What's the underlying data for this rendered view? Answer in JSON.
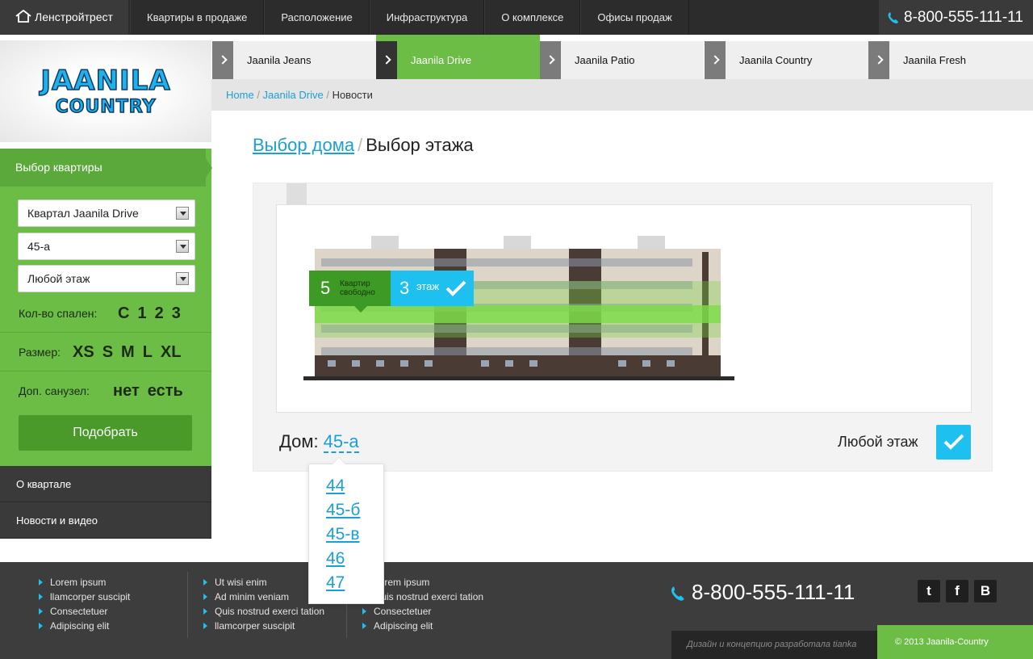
{
  "nav": {
    "brand": "Ленстройтрест",
    "items": [
      "Квартиры в продаже",
      "Расположение",
      "Инфраструктура",
      "О комплексе",
      "Офисы продаж"
    ],
    "phone": "8-800-555-111-11"
  },
  "logo": {
    "line1": "JAANILA",
    "line2": "COUNTRY"
  },
  "building_tabs": [
    {
      "label": "Jaanila Jeans",
      "active": false
    },
    {
      "label": "Jaanila Drive",
      "active": true
    },
    {
      "label": "Jaanila Patio",
      "active": false
    },
    {
      "label": "Jaanila Country",
      "active": false
    },
    {
      "label": "Jaanila Fresh",
      "active": false
    }
  ],
  "breadcrumb": {
    "home": "Home",
    "parent": "Jaanila Drive",
    "current": "Новости"
  },
  "sidebar": {
    "title": "Выбор квартиры",
    "selects": [
      "Квартал Jaanila Drive",
      "45-а",
      "Любой этаж"
    ],
    "bedrooms": {
      "label": "Кол-во спален:",
      "options": [
        "С",
        "1",
        "2",
        "3"
      ]
    },
    "size": {
      "label": "Размер:",
      "options": [
        "XS",
        "S",
        "M",
        "L",
        "XL"
      ]
    },
    "bathroom": {
      "label": "Доп. санузел:",
      "options": [
        "нет",
        "есть"
      ]
    },
    "submit": "Подобрать",
    "links": [
      "О квартале",
      "Новости и видео"
    ]
  },
  "main": {
    "title_link": "Выбор дома",
    "title_sep": "/",
    "title_current": "Выбор этажа",
    "tooltip": {
      "free_count": "5",
      "free_text_1": "Квартир",
      "free_text_2": "свободно",
      "floor_num": "3",
      "floor_text": "этаж"
    },
    "house_label": "Дом:",
    "house_value": "45-а",
    "house_options": [
      "44",
      "45-б",
      "45-в",
      "46",
      "47"
    ],
    "any_floor_label": "Любой этаж"
  },
  "footer": {
    "col1": [
      "Lorem ipsum",
      "llamcorper suscipit",
      "Consectetuer",
      "Adipiscing elit"
    ],
    "col2": [
      "Ut wisi enim",
      "Ad minim veniam",
      "Quis nostrud exerci tation",
      "llamcorper suscipit"
    ],
    "col3": [
      "Lorem ipsum",
      "Quis nostrud exerci tation",
      "Consectetuer",
      "Adipiscing elit"
    ],
    "phone": "8-800-555-111-11",
    "social": [
      "t",
      "f",
      "B"
    ],
    "credit": "Дизайн и концепцию разработала tianka",
    "copyright": "© 2013 Jaanila-Country"
  },
  "colors": {
    "green": "#6bbd46",
    "dark_green": "#4a9a2a",
    "blue": "#1ec0f0",
    "link": "#1aa0d4",
    "dark": "#2c2c2c"
  }
}
